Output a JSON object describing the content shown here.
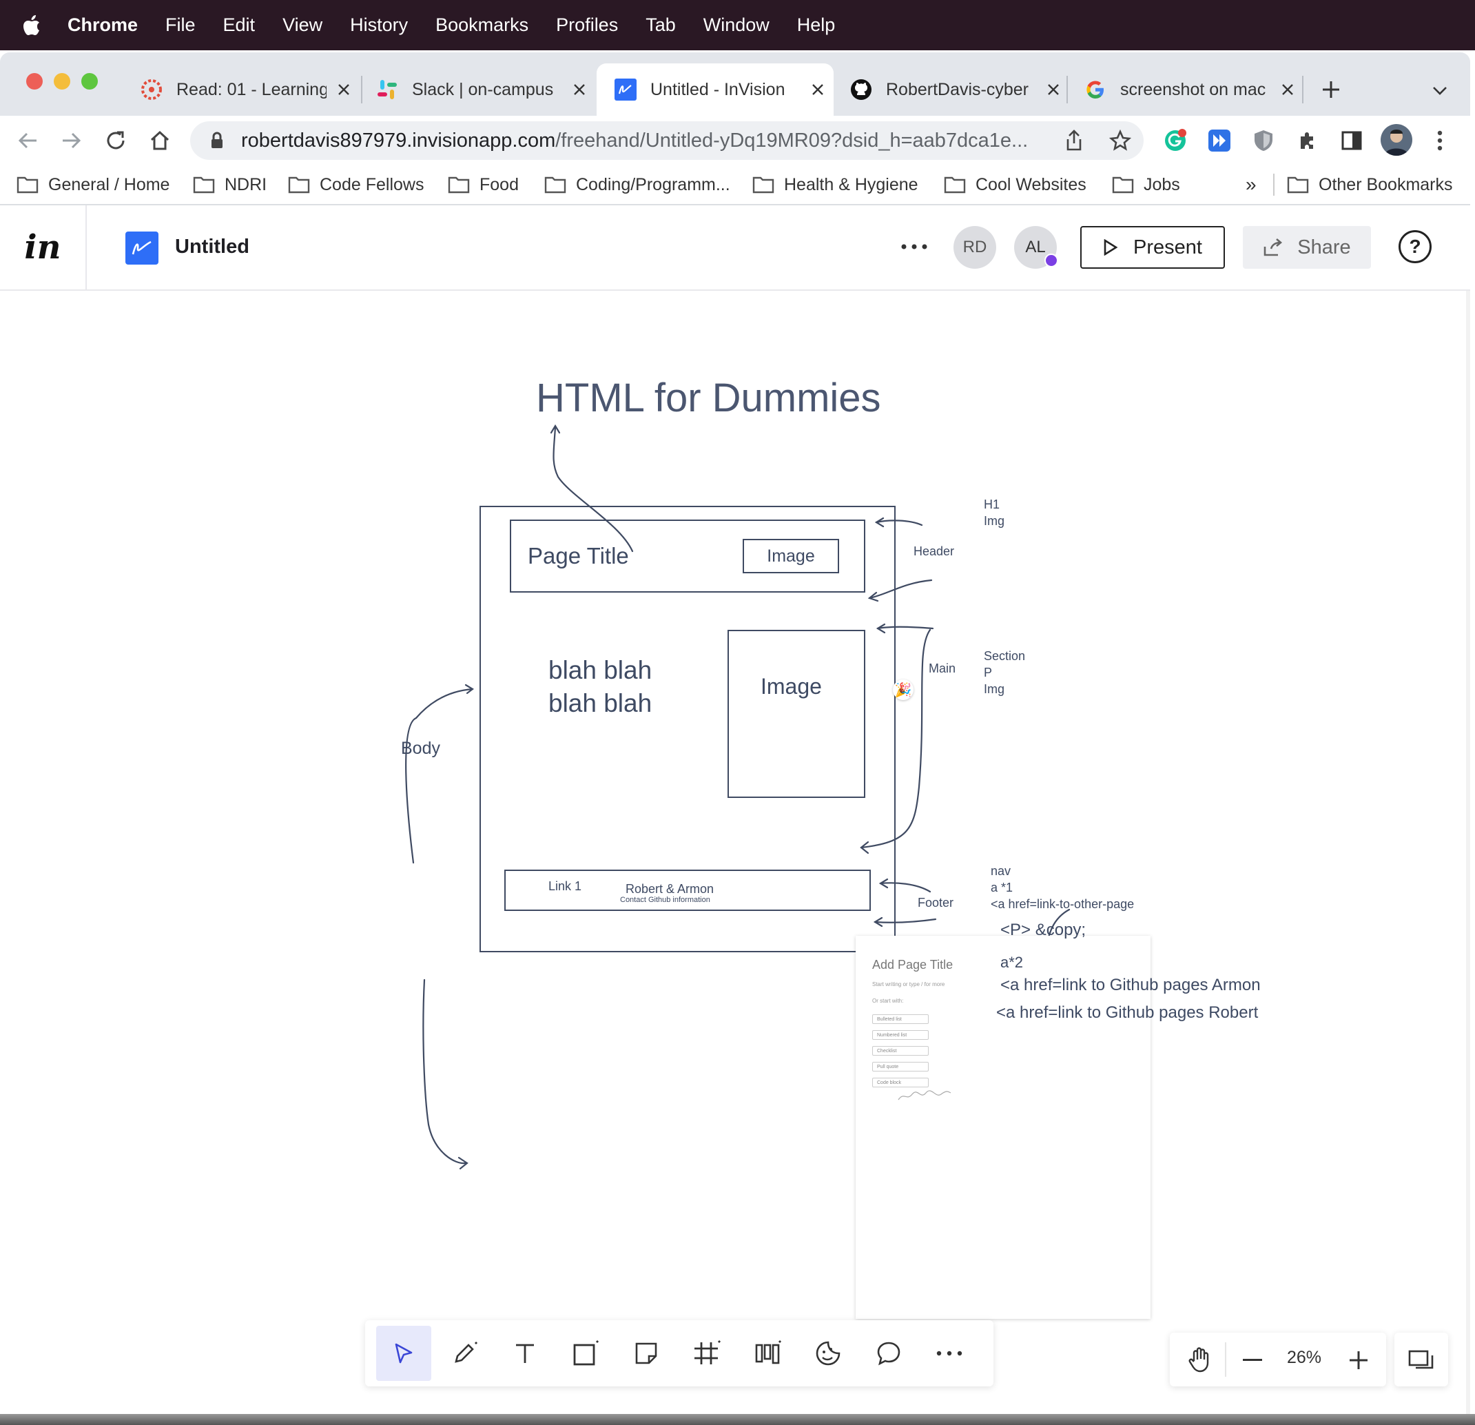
{
  "menubar": {
    "items": [
      "Chrome",
      "File",
      "Edit",
      "View",
      "History",
      "Bookmarks",
      "Profiles",
      "Tab",
      "Window",
      "Help"
    ]
  },
  "tabs": [
    {
      "title": "Read: 01 - Learning",
      "icon": "canvas-icon"
    },
    {
      "title": "Slack | on-campus",
      "icon": "slack-icon"
    },
    {
      "title": "Untitled - InVision",
      "icon": "invision-freehand-icon"
    },
    {
      "title": "RobertDavis-cyber",
      "icon": "github-icon"
    },
    {
      "title": "screenshot on mac",
      "icon": "google-icon"
    }
  ],
  "address": {
    "host": "robertdavis897979.invisionapp.com",
    "path": "/freehand/Untitled-yDq19MR09?dsid_h=aab7dca1e..."
  },
  "bookmarks": [
    "General / Home",
    "NDRI",
    "Code Fellows",
    "Food",
    "Coding/Programm...",
    "Health & Hygiene",
    "Cool Websites",
    "Jobs"
  ],
  "bookmarks_overflow": "»",
  "other_bookmarks": "Other Bookmarks",
  "app": {
    "doc_title": "Untitled",
    "avatars": [
      "RD",
      "AL"
    ],
    "present_label": "Present",
    "share_label": "Share",
    "help_label": "?"
  },
  "canvas": {
    "heading": "HTML for Dummies",
    "page_title": "Page Title",
    "header_image": "Image",
    "blah_line1": "blah blah",
    "blah_line2": "blah blah",
    "main_image": "Image",
    "body_label": "Body",
    "link1": "Link 1",
    "footer_names": "Robert & Armon",
    "footer_contact": "Contact Github information",
    "header_label": "Header",
    "main_label": "Main",
    "footer_label": "Footer",
    "header_notes": [
      "H1",
      "Img"
    ],
    "main_notes": [
      "Section",
      "P",
      "Img"
    ],
    "footer_notes": [
      "nav",
      "a *1",
      "<a href=link-to-other-page"
    ],
    "copy_note": "<P> &copy;",
    "a2_note": "a*2",
    "armon_note": "<a href=link to Github pages Armon",
    "robert_note": "<a href=link to Github pages Robert",
    "emoji": "🎉"
  },
  "note_card": {
    "title": "Add Page Title",
    "hint": "Start writing or type / for more",
    "start_with": "Or start with:",
    "options": [
      "Bulleted list",
      "Numbered list",
      "Checklist",
      "Pull quote",
      "Code block"
    ]
  },
  "zoom": {
    "level": "26%"
  }
}
